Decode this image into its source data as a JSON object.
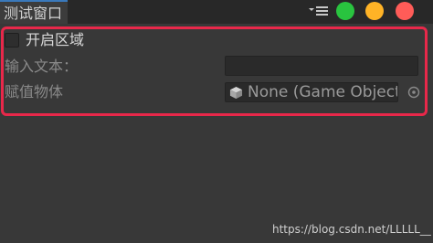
{
  "window": {
    "tab_title": "测试窗口",
    "menu_icon": "dropdown-menu-icon",
    "traffic_lights": {
      "green": "#29c43f",
      "yellow": "#ffb326",
      "red": "#ff5c58"
    }
  },
  "form": {
    "enable_toggle": {
      "label": "开启区域",
      "checked": false
    },
    "text_field": {
      "label": "输入文本：",
      "value": ""
    },
    "object_field": {
      "label": "赋值物体",
      "value": "None (Game Object)",
      "icon": "cube-icon",
      "picker_icon": "object-picker-icon"
    }
  },
  "watermark": "https://blog.csdn.net/LLLLL__",
  "colors": {
    "highlight_outline": "#e8284a",
    "tab_accent": "#3a79bb",
    "background": "#383838"
  }
}
